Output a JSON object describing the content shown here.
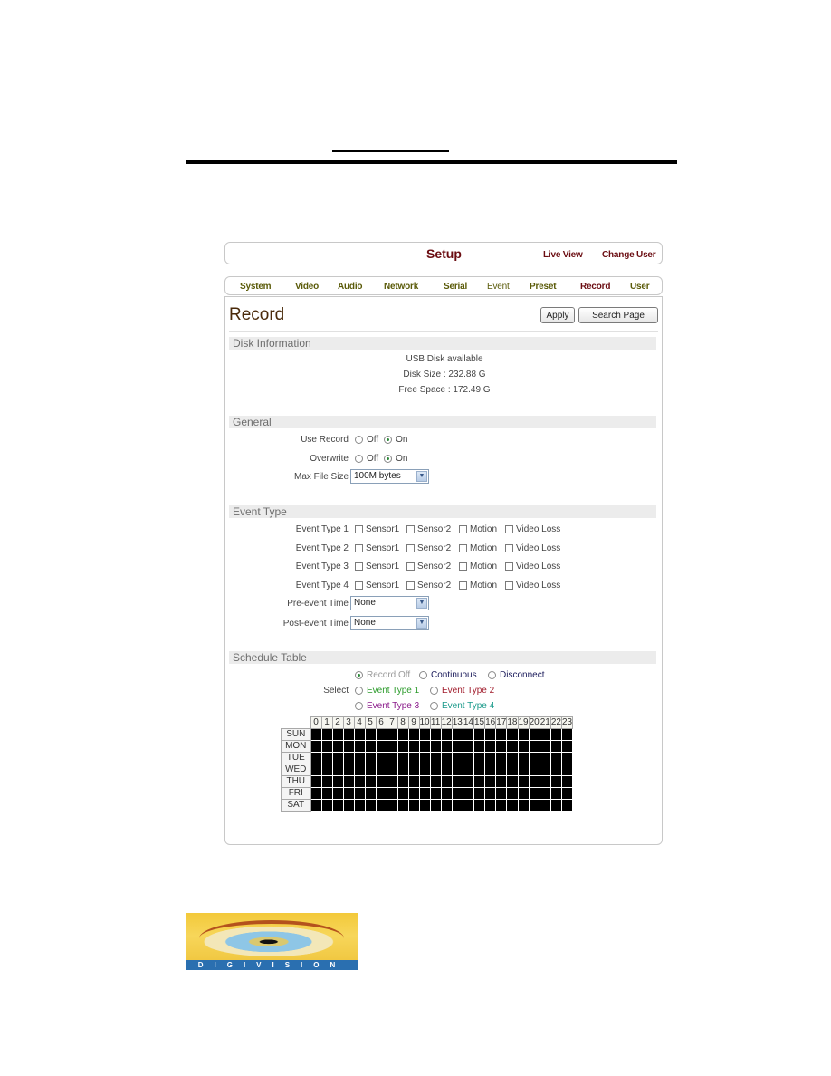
{
  "header": {
    "title": "Setup",
    "links": [
      "Live View",
      "Change User"
    ]
  },
  "nav": {
    "items": [
      "System",
      "Video",
      "Audio",
      "Network",
      "Serial",
      "Event",
      "Preset",
      "Record",
      "User"
    ],
    "active": "Record"
  },
  "page": {
    "title": "Record",
    "apply_label": "Apply",
    "search_label": "Search Page"
  },
  "disk": {
    "section": "Disk Information",
    "status": "USB Disk available",
    "size": "Disk Size : 232.88 G",
    "free": "Free Space : 172.49 G"
  },
  "general": {
    "section": "General",
    "use_record_label": "Use Record",
    "overwrite_label": "Overwrite",
    "off_label": "Off",
    "on_label": "On",
    "use_record_value": "On",
    "overwrite_value": "On",
    "max_file_size_label": "Max File Size",
    "max_file_size_value": "100M bytes"
  },
  "event_type": {
    "section": "Event Type",
    "rows": [
      "Event Type 1",
      "Event Type 2",
      "Event Type 3",
      "Event Type 4"
    ],
    "options": [
      "Sensor1",
      "Sensor2",
      "Motion",
      "Video Loss"
    ],
    "pre_event_label": "Pre-event Time",
    "pre_event_value": "None",
    "post_event_label": "Post-event Time",
    "post_event_value": "None"
  },
  "schedule": {
    "section": "Schedule Table",
    "select_label": "Select",
    "modes": [
      {
        "label": "Record Off",
        "color": "#9a9a9a",
        "checked": true
      },
      {
        "label": "Continuous",
        "color": "#1a1a5a",
        "checked": false
      },
      {
        "label": "Disconnect",
        "color": "#1a1a5a",
        "checked": false
      },
      {
        "label": "Event Type 1",
        "color": "#2a9a2a",
        "checked": false
      },
      {
        "label": "Event Type 2",
        "color": "#a01a2a",
        "checked": false
      },
      {
        "label": "Event Type 3",
        "color": "#8a1a8a",
        "checked": false
      },
      {
        "label": "Event Type 4",
        "color": "#1a9a8a",
        "checked": false
      }
    ],
    "hours": [
      "0",
      "1",
      "2",
      "3",
      "4",
      "5",
      "6",
      "7",
      "8",
      "9",
      "10",
      "11",
      "12",
      "13",
      "14",
      "15",
      "16",
      "17",
      "18",
      "19",
      "20",
      "21",
      "22",
      "23"
    ],
    "days": [
      "SUN",
      "MON",
      "TUE",
      "WED",
      "THU",
      "FRI",
      "SAT"
    ],
    "slot_color": "#000000"
  },
  "footer": {
    "logo_text": "DIGIVISION"
  }
}
